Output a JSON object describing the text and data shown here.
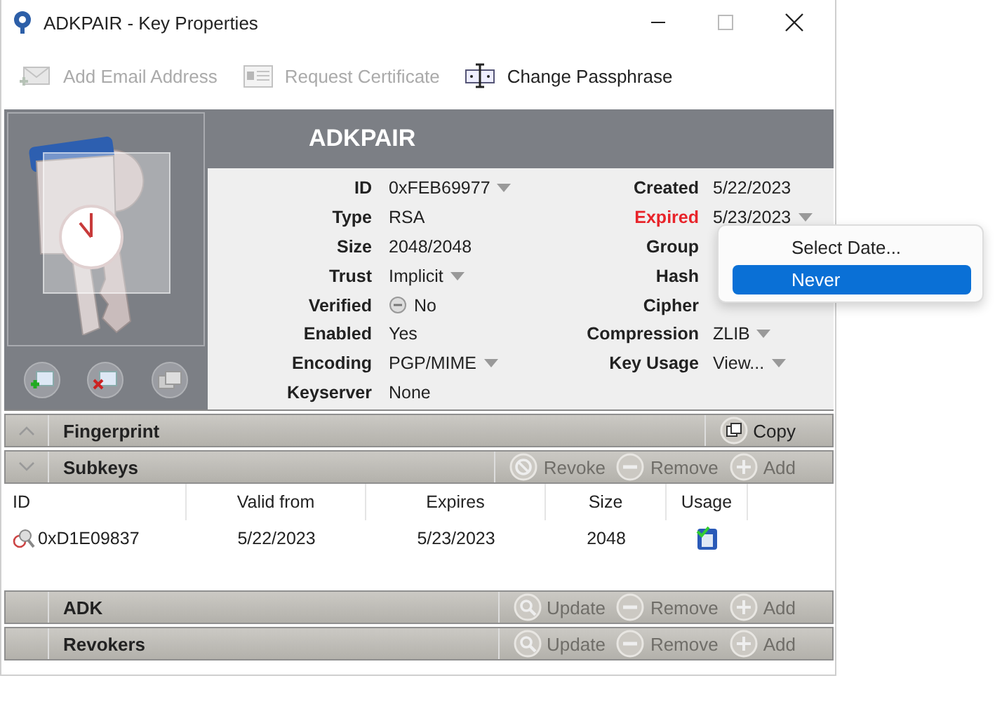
{
  "window": {
    "title": "ADKPAIR - Key Properties"
  },
  "toolbar": [
    {
      "label": "Add Email Address",
      "kind": "email",
      "disabled": true
    },
    {
      "label": "Request Certificate",
      "kind": "certificate",
      "disabled": true
    },
    {
      "label": "Change Passphrase",
      "kind": "passphrase",
      "disabled": false
    }
  ],
  "key_name": "ADKPAIR",
  "image_buttons": [
    {
      "kind": "add"
    },
    {
      "kind": "delete"
    },
    {
      "kind": "copy"
    }
  ],
  "properties_left": [
    {
      "label": "ID",
      "value": "0xFEB69977",
      "dropdown": true
    },
    {
      "label": "Type",
      "value": "RSA",
      "dropdown": false
    },
    {
      "label": "Size",
      "value": "2048/2048",
      "dropdown": false
    },
    {
      "label": "Trust",
      "value": "Implicit",
      "dropdown": true
    },
    {
      "label": "Verified",
      "value": "No",
      "dropdown": false,
      "kind": "verified"
    },
    {
      "label": "Enabled",
      "value": "Yes",
      "dropdown": false
    },
    {
      "label": "Encoding",
      "value": "PGP/MIME",
      "dropdown": true
    },
    {
      "label": "Keyserver",
      "value": "None",
      "dropdown": false
    }
  ],
  "properties_right": [
    {
      "label": "Created",
      "value": "5/22/2023",
      "dropdown": false,
      "alert": false
    },
    {
      "label": "Expired",
      "value": "5/23/2023",
      "dropdown": true,
      "alert": true
    },
    {
      "label": "Group",
      "alert": false
    },
    {
      "label": "Hash",
      "alert": false
    },
    {
      "label": "Cipher",
      "alert": false
    },
    {
      "label": "Compression",
      "value": "ZLIB",
      "dropdown": true,
      "alert": false
    },
    {
      "label": "Key Usage",
      "value": "View...",
      "dropdown": true,
      "alert": false
    }
  ],
  "expiry_menu": {
    "items": [
      {
        "label": "Select Date...",
        "selected": false
      },
      {
        "label": "Never",
        "selected": true
      }
    ]
  },
  "sections": [
    {
      "title": "Fingerprint",
      "expanded": false,
      "actions": [
        {
          "label": "Copy",
          "kind": "copy",
          "disabled": false
        }
      ]
    },
    {
      "title": "Subkeys",
      "expanded": true,
      "actions": [
        {
          "label": "Revoke",
          "kind": "revoke",
          "disabled": true
        },
        {
          "label": "Remove",
          "kind": "remove",
          "disabled": true
        },
        {
          "label": "Add",
          "kind": "add",
          "disabled": true
        }
      ],
      "table": {
        "columns": [
          "ID",
          "Valid from",
          "Expires",
          "Size",
          "Usage"
        ],
        "rows": [
          {
            "id": "0xD1E09837",
            "valid_from": "5/22/2023",
            "expires": "5/23/2023",
            "size": "2048"
          }
        ]
      }
    },
    {
      "title": "ADK",
      "actions": [
        {
          "label": "Update",
          "kind": "update",
          "disabled": true
        },
        {
          "label": "Remove",
          "kind": "remove",
          "disabled": true
        },
        {
          "label": "Add",
          "kind": "add",
          "disabled": true
        }
      ]
    },
    {
      "title": "Revokers",
      "actions": [
        {
          "label": "Update",
          "kind": "update",
          "disabled": true
        },
        {
          "label": "Remove",
          "kind": "remove",
          "disabled": true
        },
        {
          "label": "Add",
          "kind": "add",
          "disabled": true
        }
      ]
    }
  ]
}
